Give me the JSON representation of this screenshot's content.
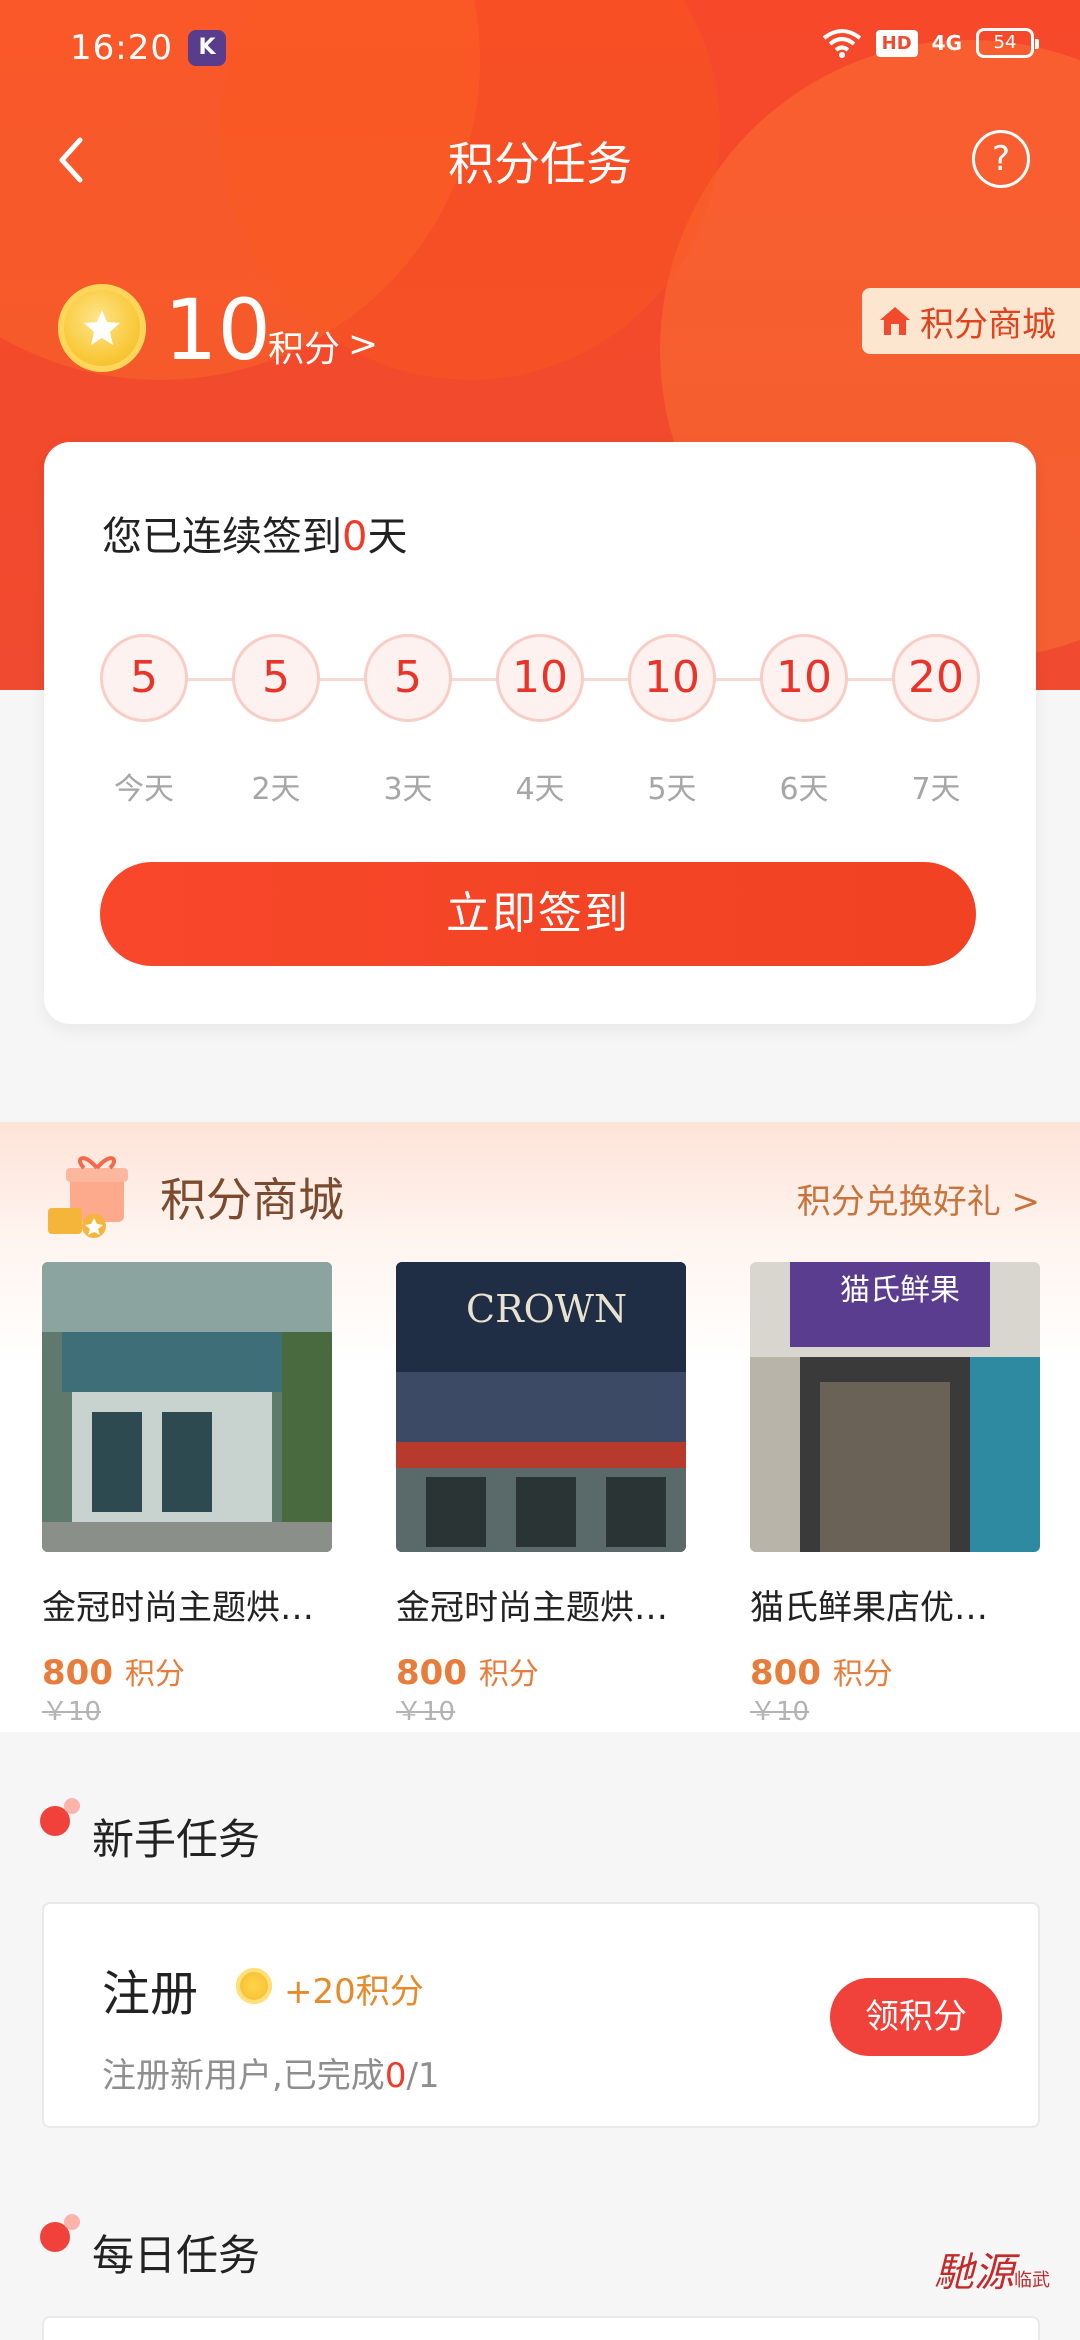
{
  "status_bar": {
    "time": "16:20",
    "app_badge": "K",
    "hd": "HD",
    "network": "4G",
    "battery": "54"
  },
  "nav": {
    "title": "积分任务",
    "help": "?"
  },
  "points": {
    "value": "10",
    "unit": "积分",
    "chevron": ">",
    "mall_label": "积分商城"
  },
  "signin": {
    "streak_prefix": "您已连续签到",
    "streak_days": "0",
    "streak_suffix": "天",
    "days": [
      {
        "points": "5",
        "label": "今天"
      },
      {
        "points": "5",
        "label": "2天"
      },
      {
        "points": "5",
        "label": "3天"
      },
      {
        "points": "10",
        "label": "4天"
      },
      {
        "points": "10",
        "label": "5天"
      },
      {
        "points": "10",
        "label": "6天"
      },
      {
        "points": "20",
        "label": "7天"
      }
    ],
    "button": "立即签到"
  },
  "mall": {
    "title": "积分商城",
    "more": "积分兑换好礼 >",
    "products": [
      {
        "name": "金冠时尚主题烘…",
        "price": "800",
        "unit": "积分",
        "original": "￥10",
        "sign": ""
      },
      {
        "name": "金冠时尚主题烘…",
        "price": "800",
        "unit": "积分",
        "original": "￥10",
        "sign": "CROWN"
      },
      {
        "name": "猫氏鲜果店优…",
        "price": "800",
        "unit": "积分",
        "original": "￥10",
        "sign": "猫氏鲜果"
      }
    ]
  },
  "newbie_tasks": {
    "title": "新手任务",
    "task": {
      "name": "注册",
      "reward": "+20积分",
      "desc_prefix": "注册新用户,已完成",
      "done": "0",
      "desc_suffix": "/1",
      "button": "领积分"
    }
  },
  "daily_tasks": {
    "title": "每日任务"
  },
  "watermark": {
    "text": "馳源",
    "small": "临武"
  },
  "colors": {
    "primary": "#f24a2c",
    "accent_orange": "#e87c3a",
    "brown": "#7c4a2e"
  }
}
